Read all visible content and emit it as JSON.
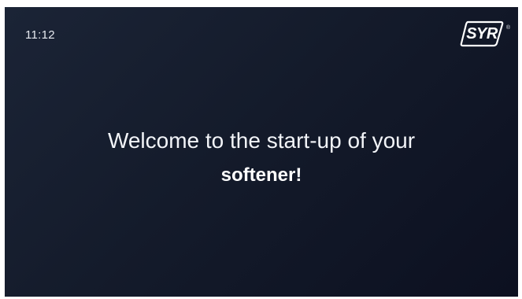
{
  "status_bar": {
    "time": "11:12"
  },
  "brand": {
    "logo_text": "SYR",
    "registered_mark": "®",
    "logo_icon": "syr-logo-icon"
  },
  "welcome": {
    "line1": "Welcome to the start-up of your",
    "line2": "softener!"
  },
  "colors": {
    "background_start": "#1b2436",
    "background_end": "#0c1020",
    "text": "#ffffff"
  }
}
